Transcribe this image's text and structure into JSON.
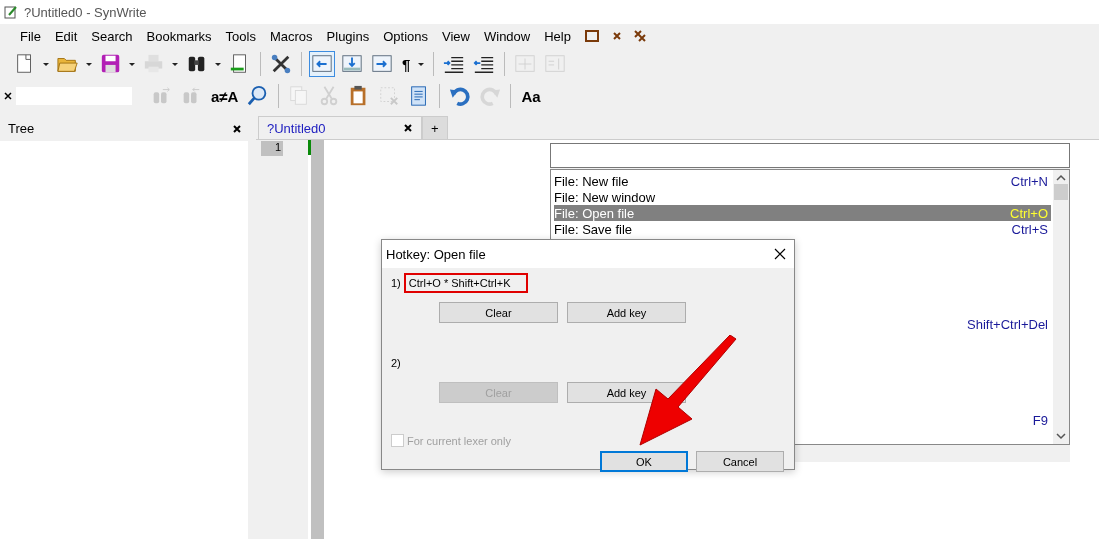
{
  "window": {
    "title": "?Untitled0 - SynWrite"
  },
  "menu": [
    "File",
    "Edit",
    "Search",
    "Bookmarks",
    "Tools",
    "Macros",
    "Plugins",
    "Options",
    "View",
    "Window",
    "Help"
  ],
  "toolbar_1": [
    {
      "kind": "new",
      "disabled": false
    },
    {
      "kind": "dropdown",
      "disabled": false
    },
    {
      "kind": "open",
      "disabled": false
    },
    {
      "kind": "dropdown",
      "disabled": false
    },
    {
      "kind": "save",
      "disabled": false
    },
    {
      "kind": "dropdown",
      "disabled": false
    },
    {
      "kind": "print",
      "disabled": true
    },
    {
      "kind": "dropdown",
      "disabled": false
    },
    {
      "kind": "binoculars",
      "disabled": false
    },
    {
      "kind": "dropdown",
      "disabled": false
    },
    {
      "kind": "goto",
      "disabled": false
    },
    {
      "kind": "sep"
    },
    {
      "kind": "tools",
      "disabled": false
    },
    {
      "kind": "sep"
    },
    {
      "kind": "panel-left",
      "disabled": false,
      "selected": true
    },
    {
      "kind": "panel-bottom",
      "disabled": false,
      "selected": false
    },
    {
      "kind": "panel-right",
      "disabled": false,
      "selected": false
    },
    {
      "kind": "glyph",
      "glyph": "¶",
      "disabled": false
    },
    {
      "kind": "dropdown",
      "disabled": false
    },
    {
      "kind": "sep"
    },
    {
      "kind": "indent",
      "disabled": false
    },
    {
      "kind": "unindent",
      "disabled": false
    },
    {
      "kind": "sep"
    },
    {
      "kind": "sync-h",
      "disabled": true
    },
    {
      "kind": "sync-v",
      "disabled": true
    }
  ],
  "toolbar_2": [
    {
      "kind": "find-next",
      "disabled": true
    },
    {
      "kind": "find-prev",
      "disabled": true
    },
    {
      "kind": "glyph",
      "glyph": "a≠A",
      "disabled": false
    },
    {
      "kind": "zoom",
      "disabled": false
    },
    {
      "kind": "sep"
    },
    {
      "kind": "copy",
      "disabled": true
    },
    {
      "kind": "cut",
      "disabled": true
    },
    {
      "kind": "paste",
      "disabled": false
    },
    {
      "kind": "delete",
      "disabled": true
    },
    {
      "kind": "document",
      "disabled": false
    },
    {
      "kind": "sep"
    },
    {
      "kind": "undo",
      "disabled": false
    },
    {
      "kind": "redo",
      "disabled": true
    },
    {
      "kind": "sep"
    },
    {
      "kind": "glyph",
      "glyph": "Aa",
      "disabled": false
    }
  ],
  "tree_panel": {
    "title": "Tree"
  },
  "tabs": [
    {
      "label": "?Untitled0",
      "selected": true
    },
    {
      "label": "+",
      "selected": false
    }
  ],
  "editor": {
    "line_numbers": [
      "1"
    ]
  },
  "command_palette": {
    "items": [
      {
        "name": "File: New file",
        "shortcut": "Ctrl+N",
        "selected": false
      },
      {
        "name": "File: New window",
        "selected": false
      },
      {
        "name": "File: Open file",
        "shortcut": "Ctrl+O",
        "selected": true
      },
      {
        "name": "File: Save file",
        "shortcut": "Ctrl+S",
        "selected": false
      }
    ],
    "covered_shortcuts": [
      "Shift+Ctrl+Del",
      "F9"
    ]
  },
  "dialog": {
    "title": "Hotkey: Open file",
    "slots": [
      {
        "label": "1)",
        "value": "Ctrl+O * Shift+Ctrl+K",
        "highlighted": true,
        "clear": {
          "label": "Clear",
          "disabled": false
        },
        "add": {
          "label": "Add key",
          "disabled": false
        }
      },
      {
        "label": "2)",
        "highlighted": false,
        "clear": {
          "label": "Clear",
          "disabled": true
        },
        "add": {
          "label": "Add key",
          "disabled": false
        }
      }
    ],
    "checkbox": {
      "label": "For current lexer only",
      "checked": false,
      "disabled": true
    },
    "buttons": [
      {
        "label": "OK",
        "default": true
      },
      {
        "label": "Cancel",
        "default": false
      }
    ]
  }
}
